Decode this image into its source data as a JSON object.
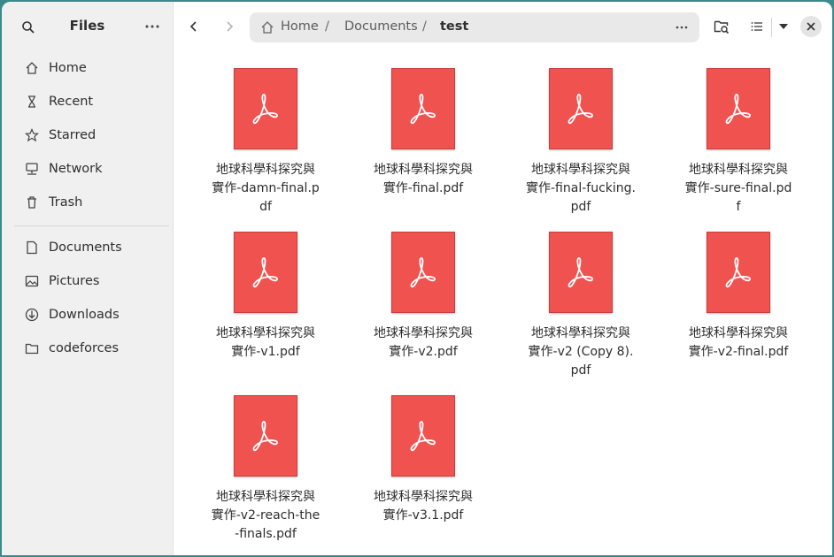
{
  "app": {
    "title": "Files"
  },
  "sidebar": {
    "places": [
      {
        "label": "Home",
        "icon": "home-icon"
      },
      {
        "label": "Recent",
        "icon": "recent-icon"
      },
      {
        "label": "Starred",
        "icon": "star-icon"
      },
      {
        "label": "Network",
        "icon": "network-icon"
      },
      {
        "label": "Trash",
        "icon": "trash-icon"
      }
    ],
    "bookmarks": [
      {
        "label": "Documents",
        "icon": "document-icon"
      },
      {
        "label": "Pictures",
        "icon": "pictures-icon"
      },
      {
        "label": "Downloads",
        "icon": "download-icon"
      },
      {
        "label": "codeforces",
        "icon": "folder-icon"
      }
    ]
  },
  "path": {
    "crumbs": [
      "Home",
      "Documents",
      "test"
    ],
    "separator": "/"
  },
  "files": [
    {
      "name": "地球科學科探究與實作-damn-final.pdf"
    },
    {
      "name": "地球科學科探究與實作-final.pdf"
    },
    {
      "name": "地球科學科探究與實作-final-fucking.pdf"
    },
    {
      "name": "地球科學科探究與實作-sure-final.pdf"
    },
    {
      "name": "地球科學科探究與實作-v1.pdf"
    },
    {
      "name": "地球科學科探究與實作-v2.pdf"
    },
    {
      "name": "地球科學科探究與實作-v2 (Copy 8).pdf"
    },
    {
      "name": "地球科學科探究與實作-v2-final.pdf"
    },
    {
      "name": "地球科學科探究與實作-v2-reach-the-finals.pdf"
    },
    {
      "name": "地球科學科探究與實作-v3.1.pdf"
    }
  ],
  "colors": {
    "pdf_icon": "#f0524f",
    "sidebar_bg": "#f0f0f0",
    "desktop_bg": "#3a8a8c"
  }
}
